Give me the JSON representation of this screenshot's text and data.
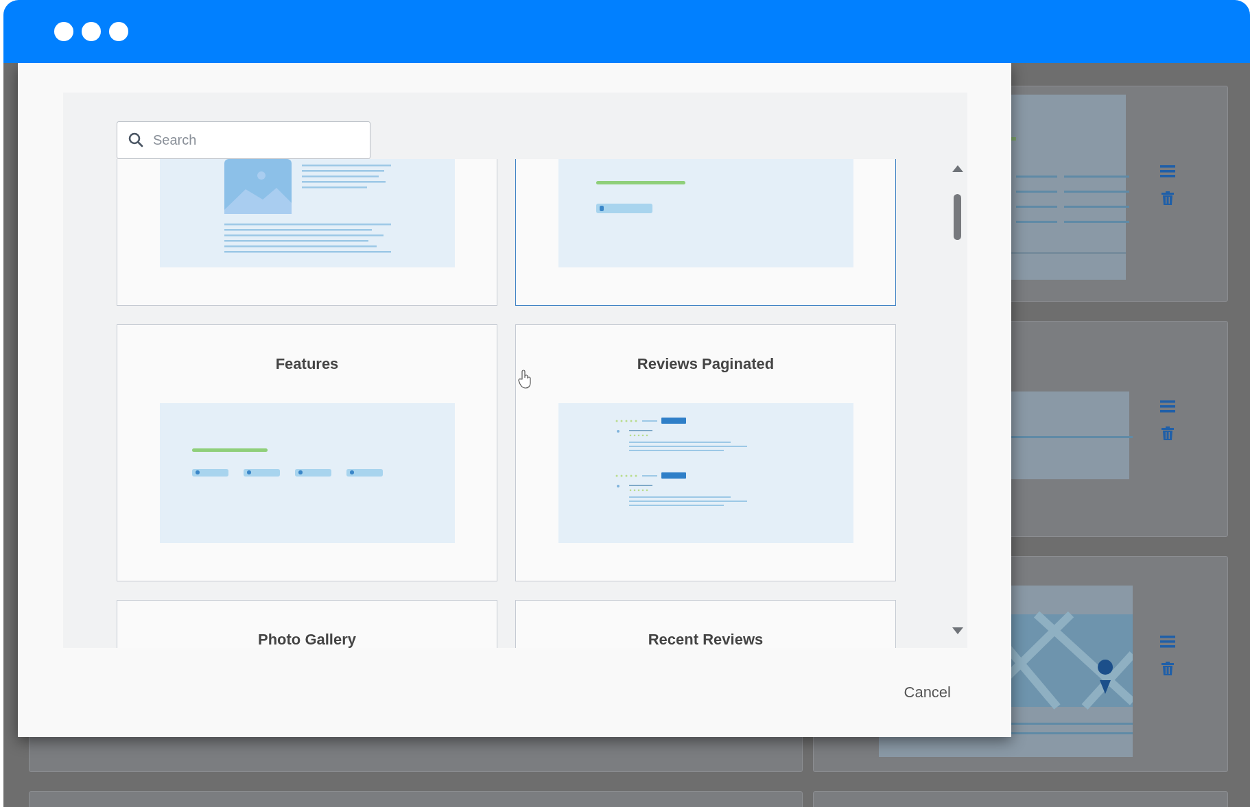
{
  "search": {
    "placeholder": "Search"
  },
  "templates": [
    {
      "kind": "image-text",
      "selected": false
    },
    {
      "kind": "heading-button",
      "selected": true
    },
    {
      "title": "Features",
      "kind": "features",
      "selected": false
    },
    {
      "title": "Reviews Paginated",
      "kind": "reviews",
      "selected": false
    },
    {
      "title": "Photo Gallery",
      "kind": "none",
      "selected": false
    },
    {
      "title": "Recent Reviews",
      "kind": "none",
      "selected": false
    }
  ],
  "background_cards": [
    {
      "kind": "text"
    },
    {
      "kind": "line"
    },
    {
      "kind": "map"
    },
    {
      "kind": "blank"
    }
  ],
  "cancel": "Cancel"
}
